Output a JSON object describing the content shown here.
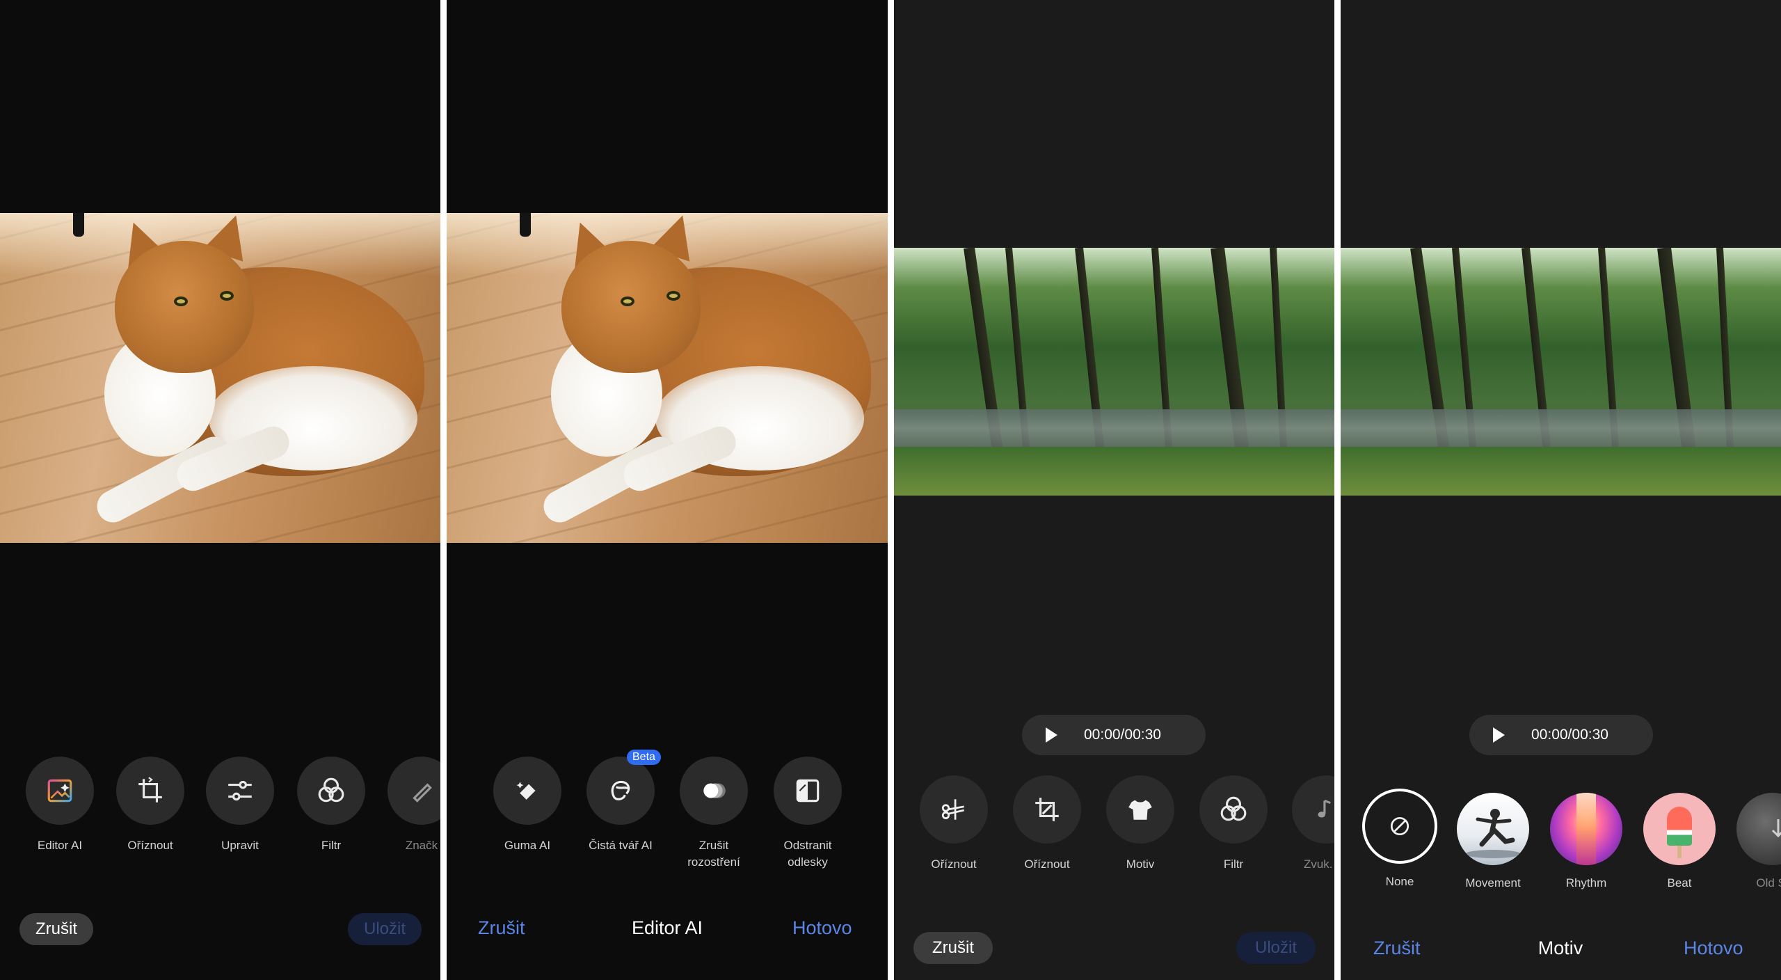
{
  "panel1": {
    "tools": [
      {
        "label": "Editor AI",
        "icon": "ai-editor-icon"
      },
      {
        "label": "Oříznout",
        "icon": "crop-icon"
      },
      {
        "label": "Upravit",
        "icon": "adjust-sliders-icon"
      },
      {
        "label": "Filtr",
        "icon": "filter-icon"
      },
      {
        "label": "Značk",
        "icon": "markup-pen-icon"
      }
    ],
    "cancel_label": "Zrušit",
    "save_label": "Uložit"
  },
  "panel2": {
    "tools": [
      {
        "label": "Guma AI",
        "icon": "eraser-icon"
      },
      {
        "label": "Čistá tvář AI",
        "icon": "face-icon",
        "badge": "Beta"
      },
      {
        "label": "Zrušit rozostření",
        "icon": "deblur-icon"
      },
      {
        "label": "Odstranit odlesky",
        "icon": "reflection-icon"
      }
    ],
    "cancel_label": "Zrušit",
    "title": "Editor AI",
    "done_label": "Hotovo"
  },
  "panel3": {
    "time": "00:00/00:30",
    "tools": [
      {
        "label": "Oříznout",
        "icon": "trim-scissors-icon"
      },
      {
        "label": "Oříznout",
        "icon": "crop-icon"
      },
      {
        "label": "Motiv",
        "icon": "theme-shirt-icon"
      },
      {
        "label": "Filtr",
        "icon": "filter-icon"
      },
      {
        "label": "Zvuk. za",
        "icon": "music-note-icon"
      }
    ],
    "cancel_label": "Zrušit",
    "save_label": "Uložit"
  },
  "panel4": {
    "time": "00:00/00:30",
    "themes": [
      {
        "label": "None",
        "selected": true
      },
      {
        "label": "Movement"
      },
      {
        "label": "Rhythm"
      },
      {
        "label": "Beat"
      },
      {
        "label": "Old St"
      }
    ],
    "cancel_label": "Zrušit",
    "title": "Motiv",
    "done_label": "Hotovo"
  },
  "colors": {
    "accent_blue": "#5b86e5",
    "beta_badge": "#2f6cf0",
    "disabled_save_text": "#3a4c7c"
  }
}
